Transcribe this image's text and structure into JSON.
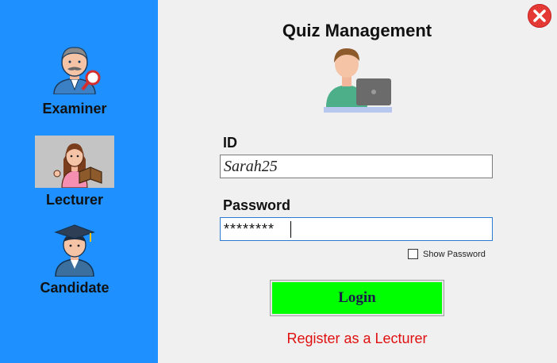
{
  "sidebar": {
    "roles": [
      {
        "label": "Examiner",
        "icon": "examiner-avatar-icon"
      },
      {
        "label": "Lecturer",
        "icon": "lecturer-avatar-icon",
        "selected": true
      },
      {
        "label": "Candidate",
        "icon": "candidate-avatar-icon"
      }
    ],
    "background": "#1e90ff"
  },
  "header": {
    "title": "Quiz Management",
    "hero_icon": "user-laptop-icon"
  },
  "form": {
    "id_label": "ID",
    "id_value": "Sarah25",
    "password_label": "Password",
    "password_value": "********",
    "show_password_label": "Show Password",
    "show_password_checked": false,
    "login_label": "Login",
    "register_label": "Register as a Lecturer"
  },
  "colors": {
    "login_button": "#00ff00",
    "register_link": "#e01010",
    "close_button": "#e53935"
  }
}
